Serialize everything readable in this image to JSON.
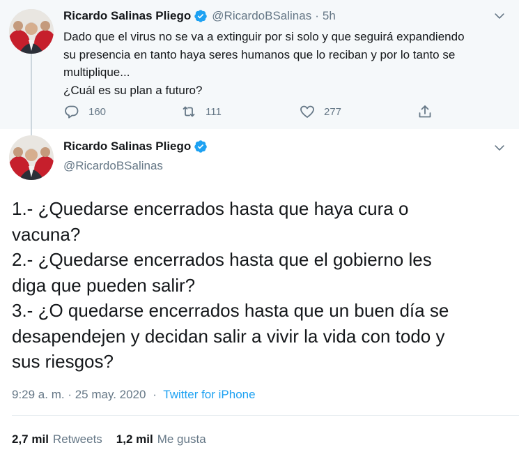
{
  "colors": {
    "accent": "#1da1f2",
    "muted": "#657786",
    "text": "#14171a",
    "parent_bg": "#f5f8fa"
  },
  "parent_tweet": {
    "name": "Ricardo Salinas Pliego",
    "verified_icon": "verified-badge-icon",
    "handle": "@RicardoBSalinas",
    "separator": "·",
    "time": "5h",
    "text_lines": [
      "Dado que el virus no se va a extinguir por si solo y que seguirá expandiendo",
      "su presencia en tanto haya seres humanos que lo reciban y por lo tanto se",
      "multiplique...",
      "¿Cuál es su plan a futuro?"
    ],
    "actions": {
      "reply_count": "160",
      "retweet_count": "111",
      "like_count": "277"
    }
  },
  "main_tweet": {
    "name": "Ricardo Salinas Pliego",
    "handle": "@RicardoBSalinas",
    "text_lines": [
      "1.- ¿Quedarse encerrados hasta que haya cura o",
      "vacuna?",
      "2.- ¿Quedarse encerrados hasta que el gobierno les",
      "diga que pueden salir?",
      "3.- ¿O quedarse encerrados hasta que un buen día se",
      "desapendejen y decidan salir a vivir la vida con todo y",
      "sus riesgos?"
    ],
    "timestamp": "9:29 a. m. · 25 may. 2020",
    "meta_separator": "·",
    "source": "Twitter for iPhone",
    "stats": {
      "retweets_count": "2,7 mil",
      "retweets_label": "Retweets",
      "likes_count": "1,2 mil",
      "likes_label": "Me gusta"
    }
  }
}
